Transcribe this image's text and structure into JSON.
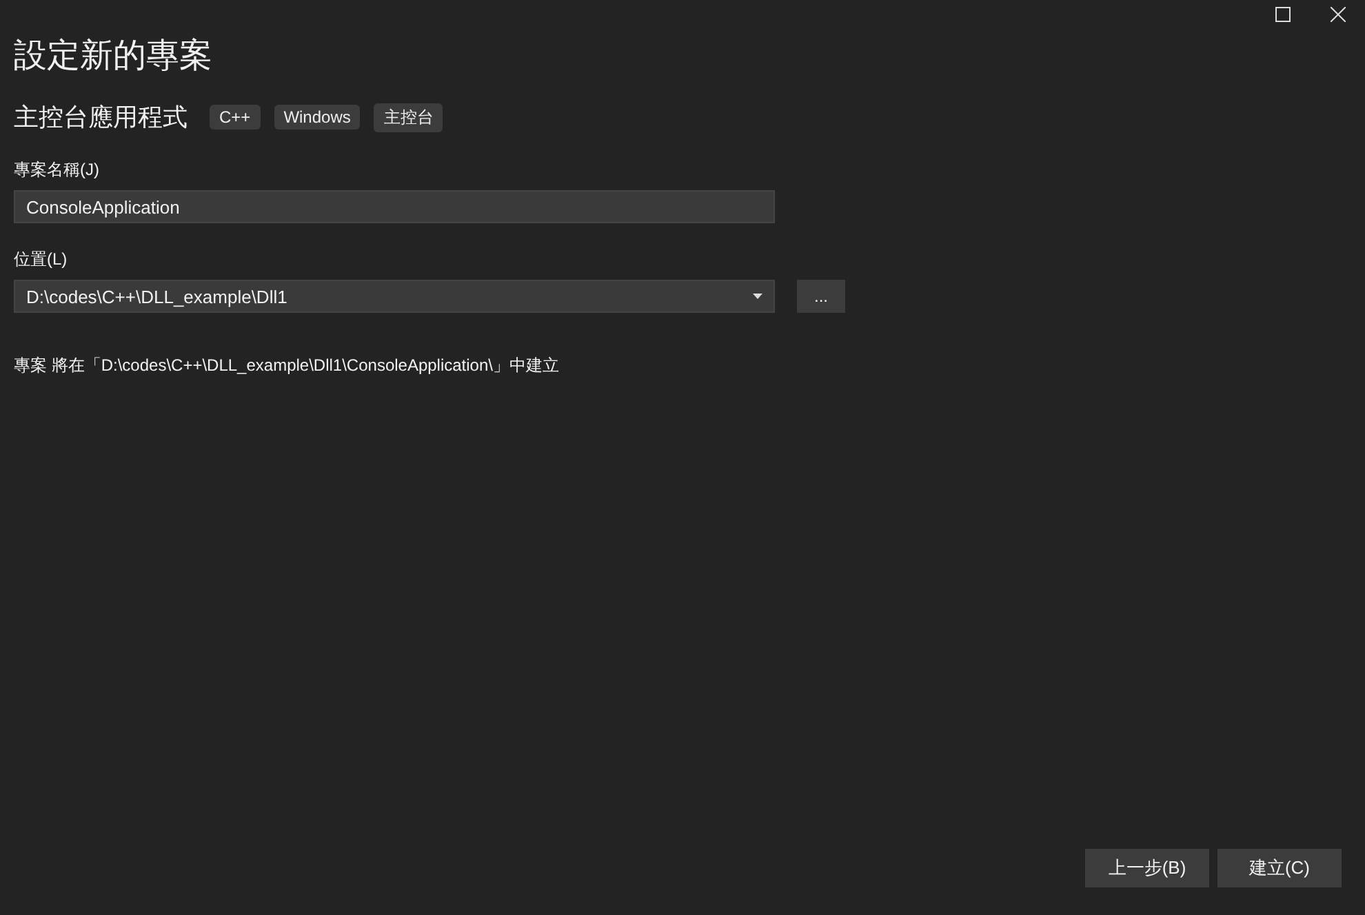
{
  "window": {
    "title": "設定新的專案"
  },
  "template": {
    "name": "主控台應用程式",
    "tags": [
      "C++",
      "Windows",
      "主控台"
    ]
  },
  "project_name": {
    "label": "專案名稱(J)",
    "value": "ConsoleApplication"
  },
  "location": {
    "label": "位置(L)",
    "value": "D:\\codes\\C++\\DLL_example\\Dll1",
    "browse": "..."
  },
  "note": "專案 將在「D:\\codes\\C++\\DLL_example\\Dll1\\ConsoleApplication\\」中建立",
  "buttons": [
    "上一步(B)",
    "建立(C)"
  ]
}
